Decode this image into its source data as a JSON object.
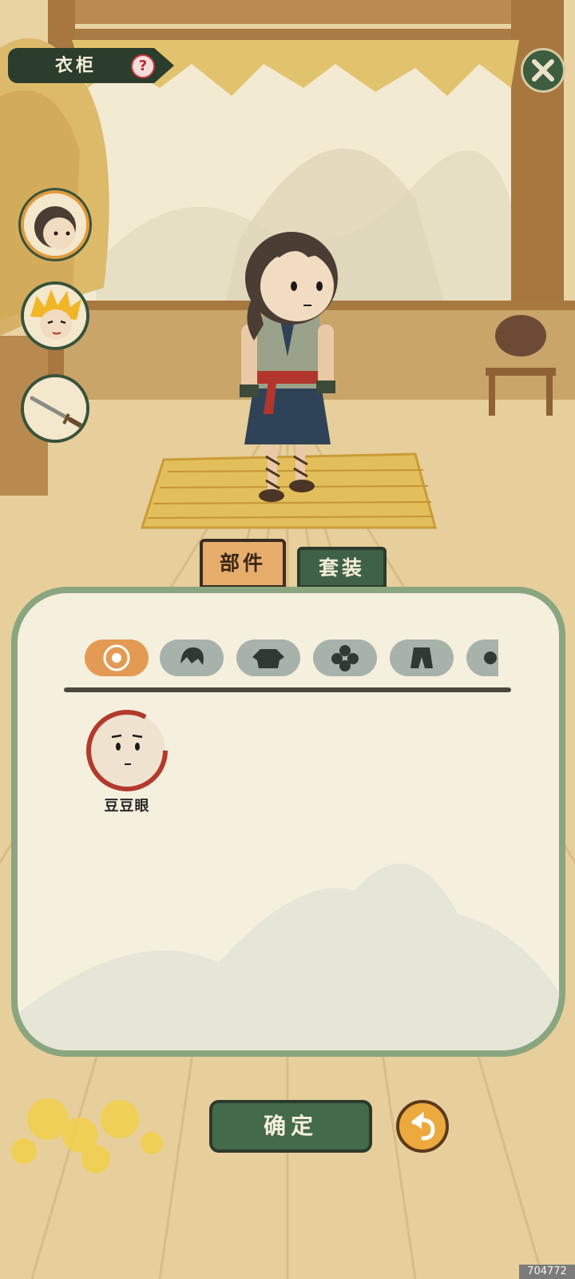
{
  "header": {
    "title": "衣柜",
    "help_glyph": "?"
  },
  "tabs": {
    "parts_label": "部件",
    "outfit_label": "套装",
    "active": "parts"
  },
  "side_buttons": [
    {
      "icon": "character-portrait-icon",
      "active": true
    },
    {
      "icon": "golden-hair-portrait-icon",
      "active": false
    },
    {
      "icon": "sword-icon",
      "active": false
    }
  ],
  "categories": [
    {
      "icon": "face-features-icon",
      "active": true
    },
    {
      "icon": "hairstyle-icon",
      "active": false
    },
    {
      "icon": "clothing-icon",
      "active": false
    },
    {
      "icon": "flower-accessory-icon",
      "active": false
    },
    {
      "icon": "pants-icon",
      "active": false
    },
    {
      "icon": "more-category-icon",
      "active": false
    }
  ],
  "items": [
    {
      "label": "豆豆眼",
      "icon": "bean-eyes-face-icon",
      "selected": true
    }
  ],
  "buttons": {
    "confirm_label": "确定"
  },
  "watermark": "704772",
  "colors": {
    "accent_green": "#3f6146",
    "accent_orange": "#e39a52",
    "panel_border": "#8aa680"
  }
}
